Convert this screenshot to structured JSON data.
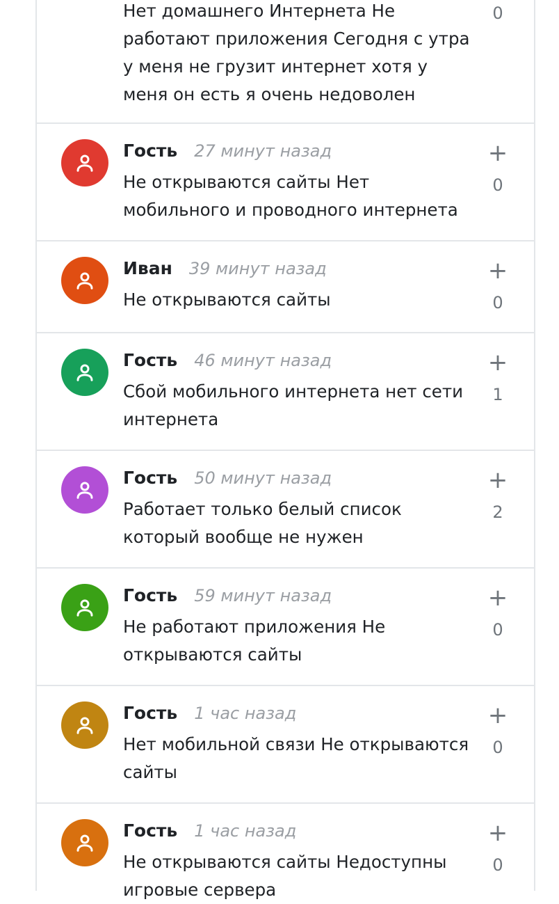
{
  "comments": [
    {
      "author": "",
      "time": "",
      "text": "Нет домашнего Интернета Не работают приложения Сегодня с утра у меня не грузит интернет хотя у меня он есть я очень недоволен",
      "votes": "0",
      "color": "#d63a86",
      "partial_top": true
    },
    {
      "author": "Гость",
      "time": "27 минут назад",
      "text": "Не открываются сайты Нет мобильного и проводного интернета",
      "votes": "0",
      "plus": "+",
      "color": "#e03a30"
    },
    {
      "author": "Иван",
      "time": "39 минут назад",
      "text": "Не открываются сайты",
      "votes": "0",
      "plus": "+",
      "color": "#e04e12"
    },
    {
      "author": "Гость",
      "time": "46 минут назад",
      "text": "Сбой мобильного интернета нет сети интернета",
      "votes": "1",
      "plus": "+",
      "color": "#17a05a"
    },
    {
      "author": "Гость",
      "time": "50 минут назад",
      "text": "Работает только белый список который вообще не нужен",
      "votes": "2",
      "plus": "+",
      "color": "#b24fd6"
    },
    {
      "author": "Гость",
      "time": "59 минут назад",
      "text": "Не работают приложения Не открываются сайты",
      "votes": "0",
      "plus": "+",
      "color": "#3aa116"
    },
    {
      "author": "Гость",
      "time": "1 час назад",
      "text": "Нет мобильной связи Не открываются сайты",
      "votes": "0",
      "plus": "+",
      "color": "#c08512"
    },
    {
      "author": "Гость",
      "time": "1 час назад",
      "text": "Не открываются сайты Недоступны игровые сервера",
      "votes": "0",
      "plus": "+",
      "color": "#d8700f"
    }
  ]
}
